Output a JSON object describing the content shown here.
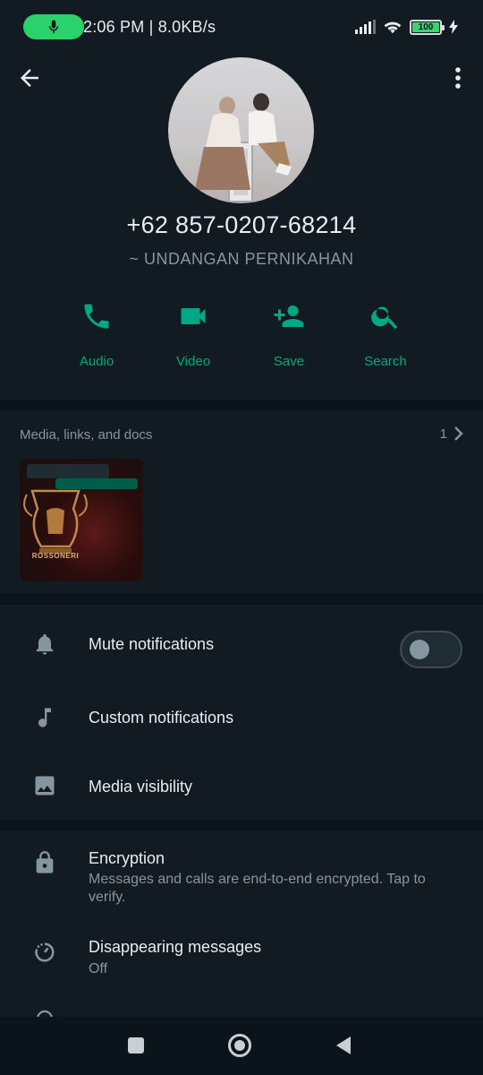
{
  "status_bar": {
    "time": "2:06 PM | 8.0KB/s",
    "battery": "100",
    "icons": [
      "mic-icon",
      "signal-icon",
      "wifi-icon",
      "battery-icon",
      "charging-icon"
    ]
  },
  "header": {
    "back_icon": "arrow-back-icon",
    "more_icon": "more-vert-icon"
  },
  "profile": {
    "phone": "+62 857-0207-68214",
    "about": "~ UNDANGAN PERNIKAHAN"
  },
  "actions": [
    {
      "label": "Audio",
      "icon": "phone-icon"
    },
    {
      "label": "Video",
      "icon": "video-icon"
    },
    {
      "label": "Save",
      "icon": "add-person-icon"
    },
    {
      "label": "Search",
      "icon": "search-icon"
    }
  ],
  "media": {
    "title": "Media, links, and docs",
    "count": "1",
    "thumb_caption": "ROSSONERI"
  },
  "settings": [
    {
      "label": "Mute notifications",
      "icon": "bell-icon",
      "toggle": false
    },
    {
      "label": "Custom notifications",
      "icon": "music-note-icon"
    },
    {
      "label": "Media visibility",
      "icon": "image-icon"
    }
  ],
  "privacy": [
    {
      "label": "Encryption",
      "sub": "Messages and calls are end-to-end encrypted. Tap to verify.",
      "icon": "lock-icon"
    },
    {
      "label": "Disappearing messages",
      "sub": "Off",
      "icon": "timer-icon"
    }
  ],
  "colors": {
    "accent": "#00a884",
    "background": "#0b141a",
    "panel": "#111b21",
    "text_primary": "#e9edef",
    "text_secondary": "#8696a0"
  }
}
